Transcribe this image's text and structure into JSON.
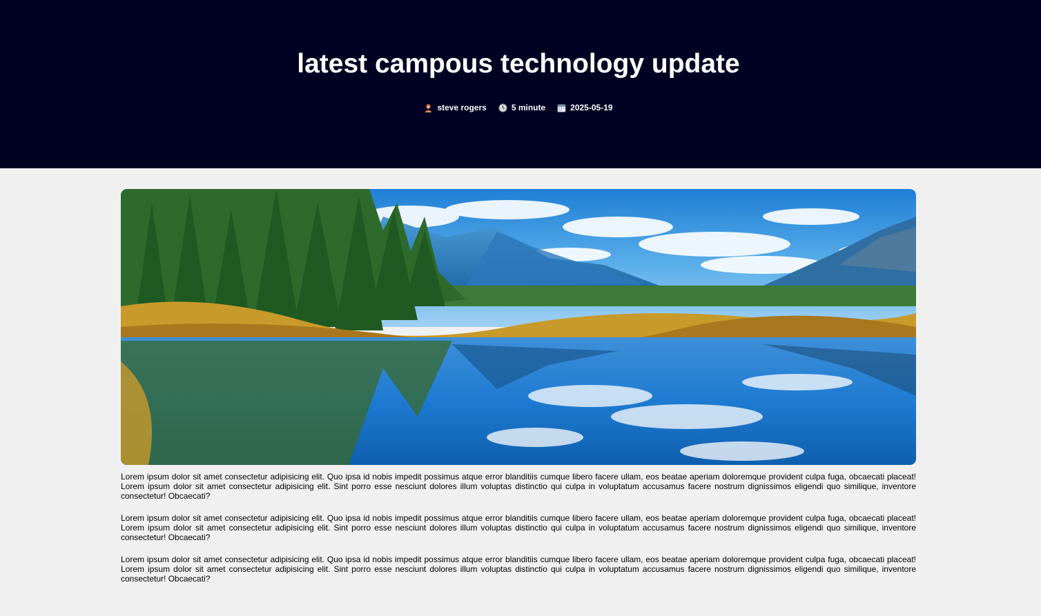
{
  "article": {
    "title": "latest campous technology update",
    "meta": {
      "author": "steve rogers",
      "author_icon": "person-avatar-icon",
      "read_time": "5 minute",
      "read_time_icon": "clock-icon",
      "date": "2025-05-19",
      "date_icon": "calendar-icon"
    },
    "image": {
      "subject": "mountain lake landscape with forest and reflection"
    },
    "paragraphs": [
      "Lorem ipsum dolor sit amet consectetur adipisicing elit. Quo ipsa id nobis impedit possimus atque error blanditiis cumque libero facere ullam, eos beatae aperiam doloremque provident culpa fuga, obcaecati placeat! Lorem ipsum dolor sit amet consectetur adipisicing elit. Sint porro esse nesciunt dolores illum voluptas distinctio qui culpa in voluptatum accusamus facere nostrum dignissimos eligendi quo similique, inventore consectetur! Obcaecati?",
      "Lorem ipsum dolor sit amet consectetur adipisicing elit. Quo ipsa id nobis impedit possimus atque error blanditiis cumque libero facere ullam, eos beatae aperiam doloremque provident culpa fuga, obcaecati placeat! Lorem ipsum dolor sit amet consectetur adipisicing elit. Sint porro esse nesciunt dolores illum voluptas distinctio qui culpa in voluptatum accusamus facere nostrum dignissimos eligendi quo similique, inventore consectetur! Obcaecati?",
      "Lorem ipsum dolor sit amet consectetur adipisicing elit. Quo ipsa id nobis impedit possimus atque error blanditiis cumque libero facere ullam, eos beatae aperiam doloremque provident culpa fuga, obcaecati placeat! Lorem ipsum dolor sit amet consectetur adipisicing elit. Sint porro esse nesciunt dolores illum voluptas distinctio qui culpa in voluptatum accusamus facere nostrum dignissimos eligendi quo similique, inventore consectetur! Obcaecati?"
    ]
  },
  "colors": {
    "hero_background": "#000022",
    "page_background": "#f0f0f0",
    "title_text": "#ffffff",
    "body_text": "#000000"
  }
}
